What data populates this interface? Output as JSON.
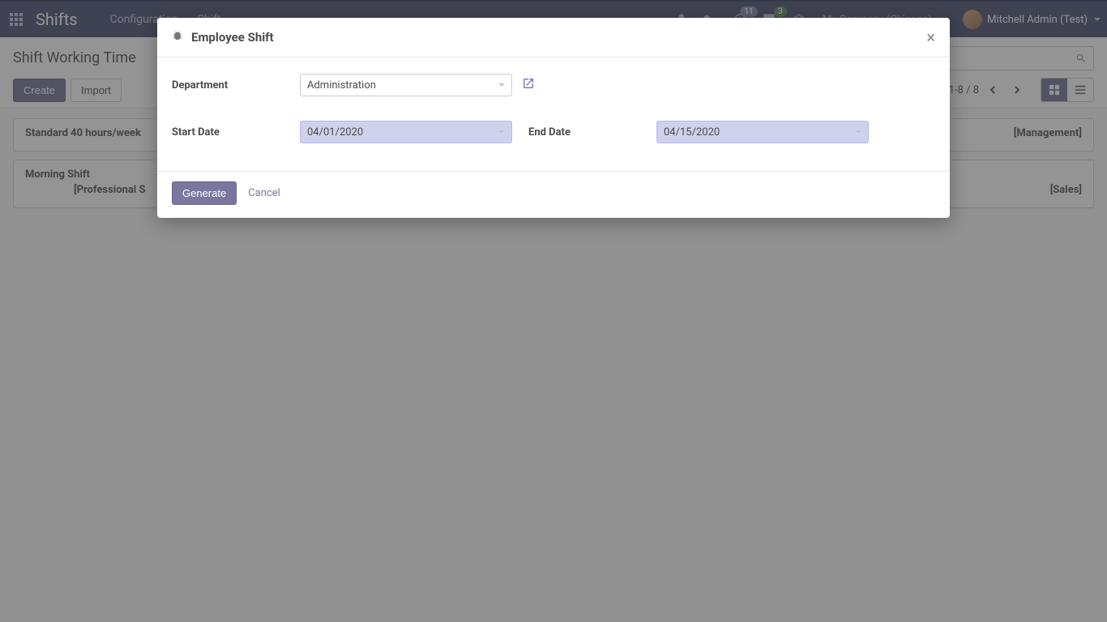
{
  "navbar": {
    "brand": "Shifts",
    "links": [
      "Configuration",
      "Shift"
    ],
    "badge_activities": "11",
    "badge_messages": "3",
    "company": "My Company (Chicago)",
    "user": "Mitchell Admin (Test)"
  },
  "control_panel": {
    "title": "Shift Working Time",
    "create": "Create",
    "import": "Import",
    "pager": "1-8 / 8"
  },
  "cards": [
    {
      "title": "Standard 40 hours/week",
      "right": "[Management]"
    },
    {
      "title": "Morning Shift",
      "sub": "[Professional S",
      "right": "[Sales]"
    }
  ],
  "modal": {
    "title": "Employee Shift",
    "labels": {
      "department": "Department",
      "start_date": "Start Date",
      "end_date": "End Date"
    },
    "values": {
      "department": "Administration",
      "start_date": "04/01/2020",
      "end_date": "04/15/2020"
    },
    "actions": {
      "generate": "Generate",
      "cancel": "Cancel"
    }
  }
}
